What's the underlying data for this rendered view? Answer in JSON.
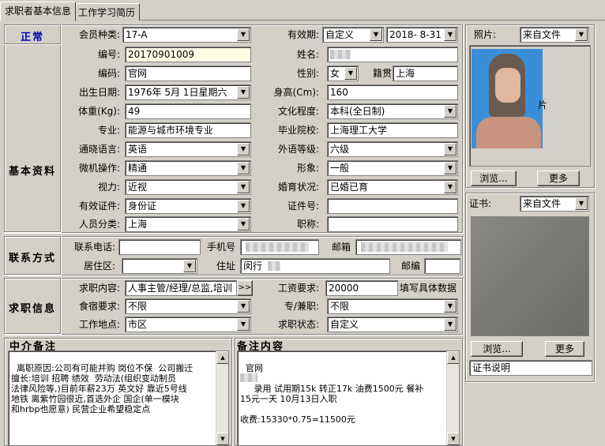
{
  "tabs": [
    {
      "label": "求职者基本信息"
    },
    {
      "label": "工作学习简历"
    }
  ],
  "status": "正常",
  "sections": {
    "basic": "基本资料",
    "contact": "联系方式",
    "job": "求职信息",
    "agent_remarks": "中介备注",
    "remarks": "备注内容"
  },
  "fields": {
    "member_type": {
      "label": "会员种类:",
      "value": "17-A"
    },
    "validity": {
      "label": "有效期:",
      "value": "自定义",
      "date": "2018- 8-31"
    },
    "number": {
      "label": "编号:",
      "value": "20170901009"
    },
    "name": {
      "label": "姓名:",
      "value": ""
    },
    "code": {
      "label": "编码:",
      "value": "官网"
    },
    "gender": {
      "label": "性别:",
      "value": "女"
    },
    "native": {
      "label": "籍贯",
      "value": "上海"
    },
    "birth": {
      "label": "出生日期:",
      "value": "1976年 5月 1日星期六"
    },
    "height": {
      "label": "身高(Cm):",
      "value": "160"
    },
    "weight": {
      "label": "体重(Kg):",
      "value": "49"
    },
    "education": {
      "label": "文化程度:",
      "value": "本科(全日制)"
    },
    "major": {
      "label": "专业:",
      "value": "能源与城市环境专业"
    },
    "school": {
      "label": "毕业院校:",
      "value": "上海理工大学"
    },
    "language": {
      "label": "通晓语言:",
      "value": "英语"
    },
    "lang_level": {
      "label": "外语等级:",
      "value": "六级"
    },
    "computer": {
      "label": "微机操作:",
      "value": "精通"
    },
    "image": {
      "label": "形象:",
      "value": "一般"
    },
    "vision": {
      "label": "视力:",
      "value": "近视"
    },
    "marital": {
      "label": "婚育状况:",
      "value": "已婚已育"
    },
    "id_type": {
      "label": "有效证件:",
      "value": "身份证"
    },
    "id_no": {
      "label": "证件号:",
      "value": ""
    },
    "category": {
      "label": "人员分类:",
      "value": "上海"
    },
    "title": {
      "label": "职称:",
      "value": ""
    },
    "phone": {
      "label": "联系电话:",
      "value": ""
    },
    "mobile": {
      "label": "手机号",
      "value": ""
    },
    "email": {
      "label": "邮箱",
      "value": ""
    },
    "district": {
      "label": "居住区:",
      "value": ""
    },
    "address": {
      "label": "住址",
      "value": "闵行"
    },
    "postcode": {
      "label": "邮编",
      "value": ""
    },
    "job_content": {
      "label": "求职内容:",
      "value": "人事主管/经理/总监,培训",
      "btn": ">>"
    },
    "salary": {
      "label": "工资要求:",
      "value": "20000",
      "hint": "填写具体数据"
    },
    "board": {
      "label": "食宿要求:",
      "value": "不限"
    },
    "fulltime": {
      "label": "专/兼职:",
      "value": "不限"
    },
    "location": {
      "label": "工作地点:",
      "value": "市区"
    },
    "job_status": {
      "label": "求职状态:",
      "value": "自定义"
    }
  },
  "photo": {
    "label": "照片:",
    "source": "来自文件",
    "browse": "浏览...",
    "more": "更多",
    "caption": "片"
  },
  "cert": {
    "label": "证书:",
    "source": "来自文件",
    "browse": "浏览...",
    "more": "更多",
    "desc": "证书说明"
  },
  "agent_remarks_text": "离职原因:公司有可能并购 岗位不保  公司搬迁\n擅长:培训 招聘 绩效  劳动法(组织变动制员\n法律风险等,)目前年薪23万 英文好 靠近5号线\n地铁 离紫竹园很近,首选外企 国企(单一模块\n和hrbp也愿意) 民营企业希望稳定点",
  "remarks_text": "官网\n\n     录用 试用期15k 转正17k 油费1500元 餐补\n15元一天 10月13日入职\n\n收费:15330*0.75=11500元"
}
